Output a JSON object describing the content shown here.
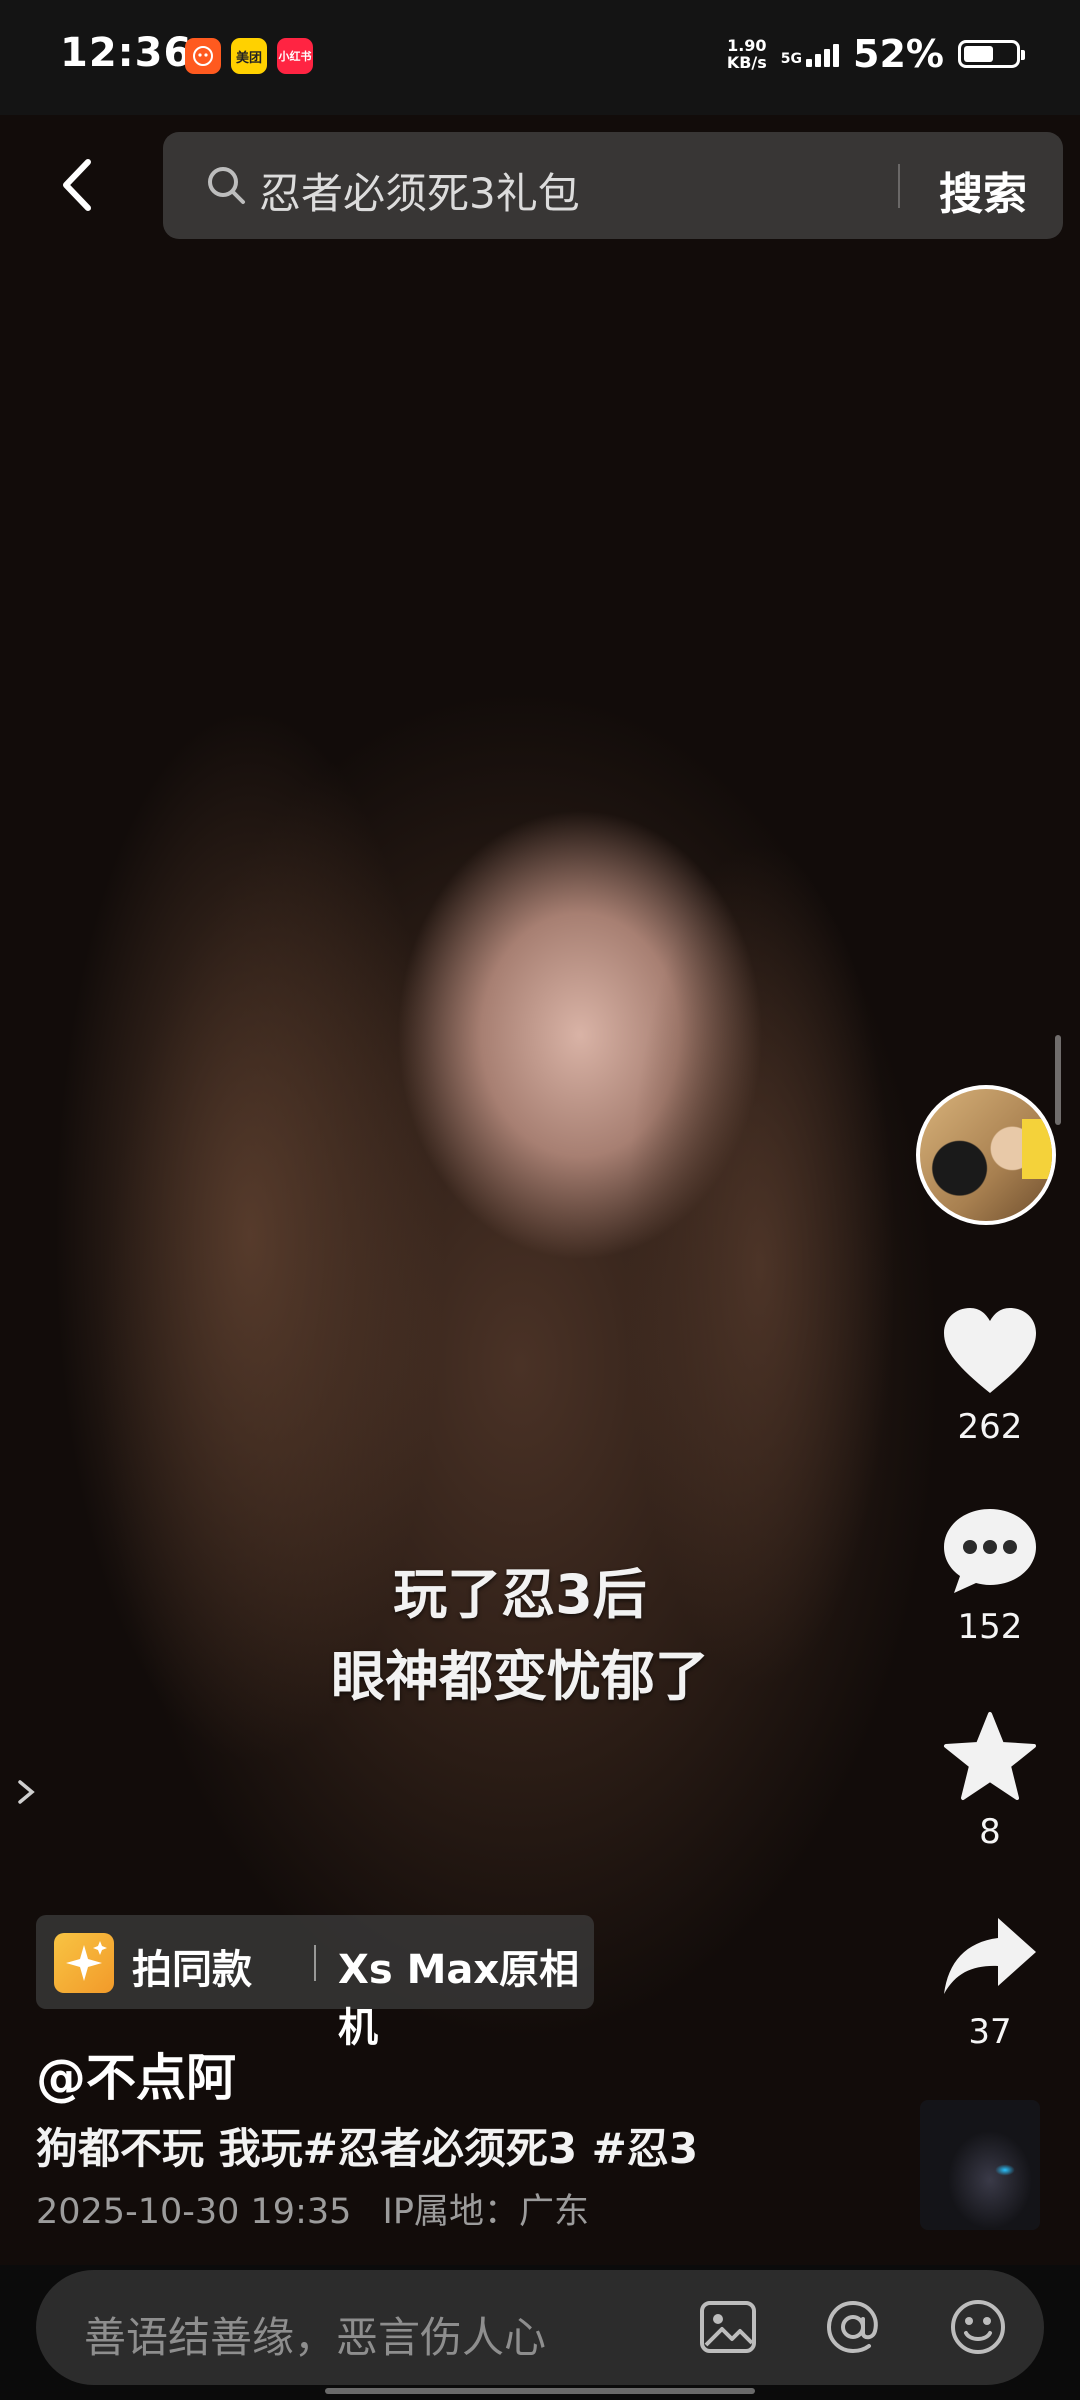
{
  "status_bar": {
    "time": "12:36",
    "apps": [
      "taobao-icon",
      "美团",
      "小红书"
    ],
    "net_speed_value": "1.90",
    "net_speed_unit": "KB/s",
    "network": "5G",
    "battery_pct": "52%",
    "battery_level": 0.52
  },
  "search": {
    "query": "忍者必须死3礼包",
    "button": "搜索"
  },
  "video": {
    "caption_line1": "玩了忍3后",
    "caption_line2": "眼神都变忧郁了"
  },
  "rail": {
    "likes": "262",
    "comments": "152",
    "favorites": "8",
    "shares": "37"
  },
  "template_chip": {
    "label": "拍同款",
    "camera": "Xs Max原相机"
  },
  "post": {
    "author": "@不点阿",
    "description": "狗都不玩 我玩#忍者必须死3 #忍3",
    "datetime": "2025-10-30 19:35",
    "ip_location": "IP属地：广东"
  },
  "comment_bar": {
    "placeholder": "善语结善缘，恶言伤人心"
  },
  "colors": {
    "accent_chip": "#f8c443",
    "background": "#0b0b0b"
  }
}
